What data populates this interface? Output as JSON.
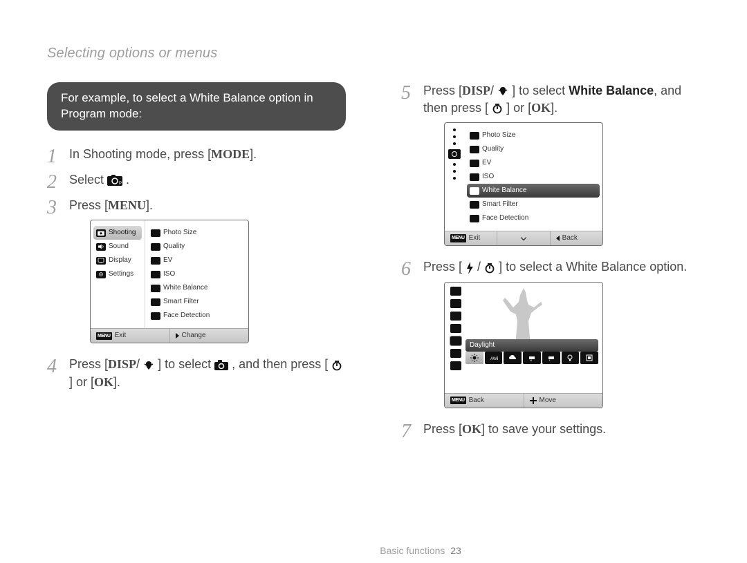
{
  "header": "Selecting options or menus",
  "callout": "For example, to select a White Balance option in Program mode:",
  "steps": {
    "s1_a": "In Shooting mode, press [",
    "s1_btn": "MODE",
    "s1_b": "].",
    "s2_a": "Select ",
    "s2_b": ".",
    "s3_a": "Press [",
    "s3_btn": "MENU",
    "s3_b": "].",
    "s4_a": "Press [",
    "s4_btn1": "DISP",
    "s4_b": "/",
    "s4_c": "] to select ",
    "s4_d": ", and then press [",
    "s4_e": "] or [",
    "s4_btn2": "OK",
    "s4_f": "].",
    "s5_a": "Press [",
    "s5_btn1": "DISP",
    "s5_b": "/",
    "s5_c": "] to select ",
    "s5_bold": "White Balance",
    "s5_d": ", and then press [",
    "s5_e": "] or [",
    "s5_btn2": "OK",
    "s5_f": "].",
    "s6_a": "Press [",
    "s6_b": "/",
    "s6_c": "] to select a White Balance option.",
    "s7_a": "Press [",
    "s7_btn": "OK",
    "s7_b": "] to save your settings."
  },
  "screen1": {
    "left": [
      "Shooting",
      "Sound",
      "Display",
      "Settings"
    ],
    "right": [
      "Photo Size",
      "Quality",
      "EV",
      "ISO",
      "White Balance",
      "Smart Filter",
      "Face Detection"
    ],
    "footer": {
      "exit": "Exit",
      "change": "Change",
      "menu": "MENU"
    }
  },
  "screen2": {
    "right": [
      "Photo Size",
      "Quality",
      "EV",
      "ISO",
      "White Balance",
      "Smart Filter",
      "Face Detection"
    ],
    "footer": {
      "exit": "Exit",
      "back": "Back",
      "menu": "MENU"
    }
  },
  "screen3": {
    "selected": "Daylight",
    "footer": {
      "back": "Back",
      "move": "Move",
      "menu": "MENU"
    }
  },
  "footer": {
    "section": "Basic functions",
    "page": "23"
  }
}
